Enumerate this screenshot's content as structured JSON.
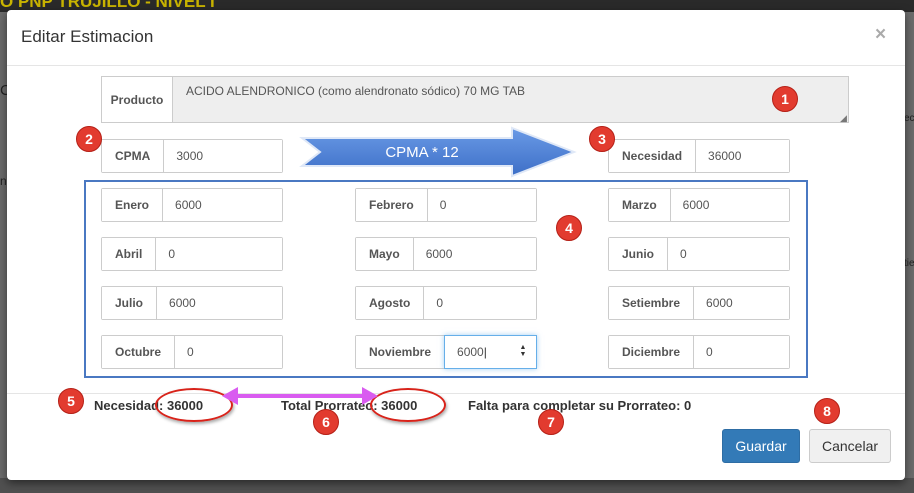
{
  "background": {
    "header_text": "O PNP TRUJILLO - NIVEL I",
    "left_fragments": [
      "C",
      "n"
    ],
    "right_fragments": [
      "ec",
      "tie"
    ]
  },
  "modal": {
    "title": "Editar Estimacion",
    "close_glyph": "×"
  },
  "product": {
    "label": "Producto",
    "value": "ACIDO ALENDRONICO (como alendronato sódico) 70 MG TAB"
  },
  "cpma": {
    "label": "CPMA",
    "value": "3000"
  },
  "arrow": {
    "label": "CPMA * 12"
  },
  "necesidad": {
    "label": "Necesidad",
    "value": "36000"
  },
  "months": [
    {
      "label": "Enero",
      "value": "6000"
    },
    {
      "label": "Febrero",
      "value": "0"
    },
    {
      "label": "Marzo",
      "value": "6000"
    },
    {
      "label": "Abril",
      "value": "0"
    },
    {
      "label": "Mayo",
      "value": "6000"
    },
    {
      "label": "Junio",
      "value": "0"
    },
    {
      "label": "Julio",
      "value": "6000"
    },
    {
      "label": "Agosto",
      "value": "0"
    },
    {
      "label": "Setiembre",
      "value": "6000"
    },
    {
      "label": "Octubre",
      "value": "0"
    },
    {
      "label": "Noviembre",
      "value": "6000"
    },
    {
      "label": "Diciembre",
      "value": "0"
    }
  ],
  "summary": {
    "necesidad": "Necesidad: 36000",
    "total_prorrateo": "Total Prorrateo: 36000",
    "falta": "Falta para completar su Prorrateo: 0"
  },
  "buttons": {
    "guardar": "Guardar",
    "cancelar": "Cancelar"
  },
  "badges": [
    "1",
    "2",
    "3",
    "4",
    "5",
    "6",
    "7",
    "8"
  ],
  "colors": {
    "badge_red": "#e23b2f",
    "arrow_blue": "#4a7fd4",
    "double_arrow_magenta": "#d95cf0",
    "box_blue": "#4a78c2",
    "primary": "#337ab7"
  }
}
